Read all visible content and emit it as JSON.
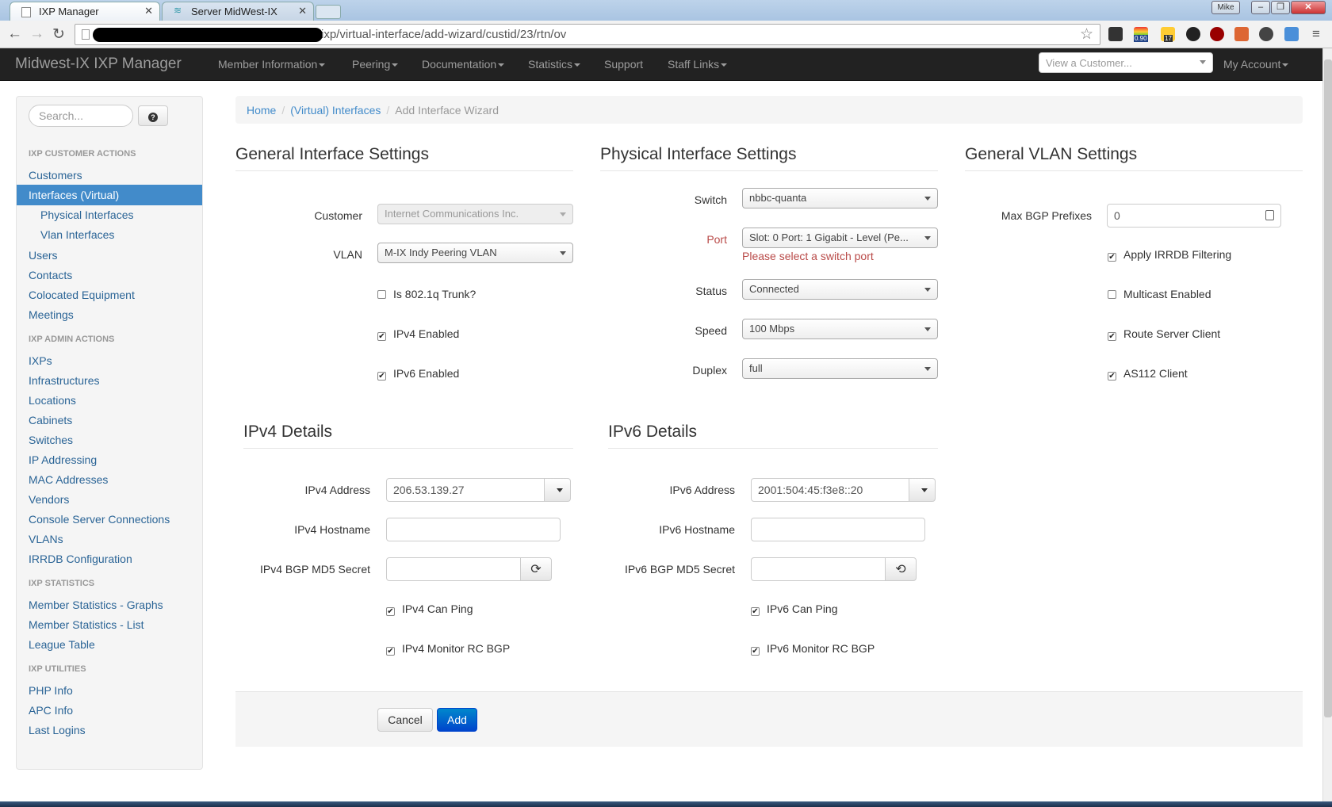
{
  "browser": {
    "tabs": [
      {
        "label": "IXP Manager",
        "active": true
      },
      {
        "label": "Server MidWest-IX",
        "active": false
      }
    ],
    "user_badge": "Mike",
    "url": "ixp/virtual-interface/add-wizard/custid/23/rtn/ov",
    "ext_badges": [
      "0.90",
      "17"
    ]
  },
  "navbar": {
    "brand": "Midwest-IX IXP Manager",
    "items": [
      "Member Information",
      "Peering",
      "Documentation",
      "Statistics",
      "Support",
      "Staff Links"
    ],
    "customer_select_placeholder": "View a Customer...",
    "account": "My Account"
  },
  "sidebar": {
    "search_placeholder": "Search...",
    "help_icon": "?",
    "sections": [
      {
        "title": "IXP CUSTOMER ACTIONS",
        "items": [
          "Customers",
          "Interfaces (Virtual)",
          "Physical Interfaces",
          "Vlan Interfaces",
          "Users",
          "Contacts",
          "Colocated Equipment",
          "Meetings"
        ]
      },
      {
        "title": "IXP ADMIN ACTIONS",
        "items": [
          "IXPs",
          "Infrastructures",
          "Locations",
          "Cabinets",
          "Switches",
          "IP Addressing",
          "MAC Addresses",
          "Vendors",
          "Console Server Connections",
          "VLANs",
          "IRRDB Configuration"
        ]
      },
      {
        "title": "IXP STATISTICS",
        "items": [
          "Member Statistics - Graphs",
          "Member Statistics - List",
          "League Table"
        ]
      },
      {
        "title": "IXP UTILITIES",
        "items": [
          "PHP Info",
          "APC Info",
          "Last Logins"
        ]
      }
    ],
    "active_item": "Interfaces (Virtual)"
  },
  "breadcrumb": [
    "Home",
    "(Virtual) Interfaces",
    "Add Interface Wizard"
  ],
  "general": {
    "title": "General Interface Settings",
    "customer_label": "Customer",
    "customer_value": "Internet Communications Inc.",
    "vlan_label": "VLAN",
    "vlan_value": "M-IX Indy Peering VLAN",
    "trunk_label": "Is 802.1q Trunk?",
    "trunk_checked": false,
    "ipv4_label": "IPv4 Enabled",
    "ipv4_checked": true,
    "ipv6_label": "IPv6 Enabled",
    "ipv6_checked": true
  },
  "physical": {
    "title": "Physical Interface Settings",
    "switch_label": "Switch",
    "switch_value": "nbbc-quanta",
    "port_label": "Port",
    "port_value": "Slot: 0 Port: 1 Gigabit - Level (Pe...",
    "port_error": "Please select a switch port",
    "status_label": "Status",
    "status_value": "Connected",
    "speed_label": "Speed",
    "speed_value": "100 Mbps",
    "duplex_label": "Duplex",
    "duplex_value": "full"
  },
  "vlan": {
    "title": "General VLAN Settings",
    "maxbgp_label": "Max BGP Prefixes",
    "maxbgp_value": "0",
    "irrdb_label": "Apply IRRDB Filtering",
    "irrdb_checked": true,
    "multicast_label": "Multicast Enabled",
    "multicast_checked": false,
    "rsclient_label": "Route Server Client",
    "rsclient_checked": true,
    "as112_label": "AS112 Client",
    "as112_checked": true
  },
  "ipv4": {
    "title": "IPv4 Details",
    "address_label": "IPv4 Address",
    "address_value": "206.53.139.27",
    "hostname_label": "IPv4 Hostname",
    "hostname_value": "",
    "md5_label": "IPv4 BGP MD5 Secret",
    "md5_value": "",
    "ping_label": "IPv4 Can Ping",
    "ping_checked": true,
    "monitor_label": "IPv4 Monitor RC BGP",
    "monitor_checked": true
  },
  "ipv6": {
    "title": "IPv6 Details",
    "address_label": "IPv6 Address",
    "address_value": "2001:504:45:f3e8::20",
    "hostname_label": "IPv6 Hostname",
    "hostname_value": "",
    "md5_label": "IPv6 BGP MD5 Secret",
    "md5_value": "",
    "ping_label": "IPv6 Can Ping",
    "ping_checked": true,
    "monitor_label": "IPv6 Monitor RC BGP",
    "monitor_checked": true
  },
  "actions": {
    "cancel": "Cancel",
    "add": "Add"
  },
  "colors": {
    "navbar": "#222222",
    "link": "#2a6496",
    "active": "#428bca",
    "primary": "#0055cc",
    "error": "#b94a48"
  }
}
